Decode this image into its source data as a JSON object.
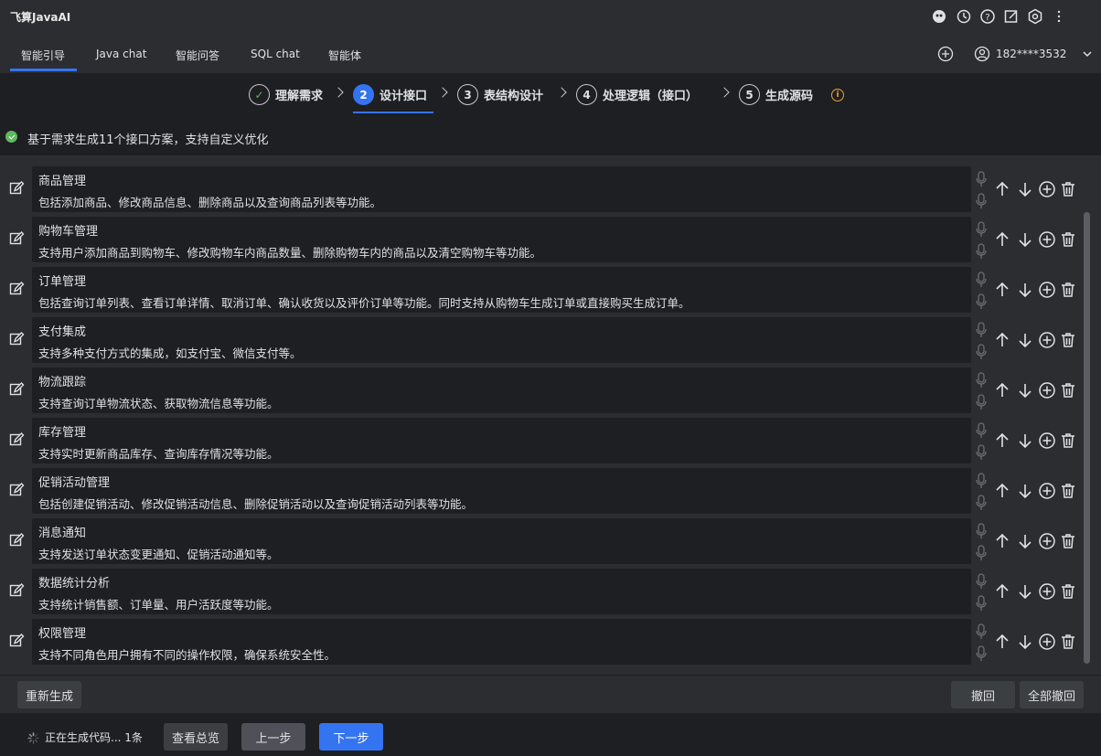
{
  "app": {
    "title": "飞算JavaAI"
  },
  "title_icons": [
    "brain-icon",
    "history-icon",
    "help-icon",
    "edit-icon",
    "settings-icon",
    "more-icon"
  ],
  "tabs": [
    {
      "label": "智能引导",
      "active": true
    },
    {
      "label": "Java chat",
      "active": false
    },
    {
      "label": "智能问答",
      "active": false
    },
    {
      "label": "SQL chat",
      "active": false
    },
    {
      "label": "智能体",
      "active": false
    }
  ],
  "user": {
    "name": "182****3532"
  },
  "steps": [
    {
      "num": "✓",
      "label": "理解需求",
      "state": "done"
    },
    {
      "num": "2",
      "label": "设计接口",
      "state": "active"
    },
    {
      "num": "3",
      "label": "表结构设计",
      "state": "pending"
    },
    {
      "num": "4",
      "label": "处理逻辑（接口）",
      "state": "pending"
    },
    {
      "num": "5",
      "label": "生成源码",
      "state": "pending"
    }
  ],
  "status": {
    "text": "基于需求生成11个接口方案，支持自定义优化"
  },
  "items": [
    {
      "title": "商品管理",
      "desc": "包括添加商品、修改商品信息、删除商品以及查询商品列表等功能。"
    },
    {
      "title": "购物车管理",
      "desc": "支持用户添加商品到购物车、修改购物车内商品数量、删除购物车内的商品以及清空购物车等功能。"
    },
    {
      "title": "订单管理",
      "desc": "包括查询订单列表、查看订单详情、取消订单、确认收货以及评价订单等功能。同时支持从购物车生成订单或直接购买生成订单。"
    },
    {
      "title": "支付集成",
      "desc": "支持多种支付方式的集成，如支付宝、微信支付等。"
    },
    {
      "title": "物流跟踪",
      "desc": "支持查询订单物流状态、获取物流信息等功能。"
    },
    {
      "title": "库存管理",
      "desc": "支持实时更新商品库存、查询库存情况等功能。"
    },
    {
      "title": "促销活动管理",
      "desc": "包括创建促销活动、修改促销活动信息、删除促销活动以及查询促销活动列表等功能。"
    },
    {
      "title": "消息通知",
      "desc": "支持发送订单状态变更通知、促销活动通知等。"
    },
    {
      "title": "数据统计分析",
      "desc": "支持统计销售额、订单量、用户活跃度等功能。"
    },
    {
      "title": "权限管理",
      "desc": "支持不同角色用户拥有不同的操作权限，确保系统安全性。"
    }
  ],
  "buttons": {
    "regenerate": "重新生成",
    "undo": "撤回",
    "undo_all": "全部撤回",
    "overview": "查看总览",
    "prev": "上一步",
    "next": "下一步"
  },
  "footer": {
    "generating": "正在生成代码... 1条"
  },
  "colors": {
    "accent": "#3574f0",
    "success": "#5fb85f",
    "warning": "#e8a33d"
  }
}
